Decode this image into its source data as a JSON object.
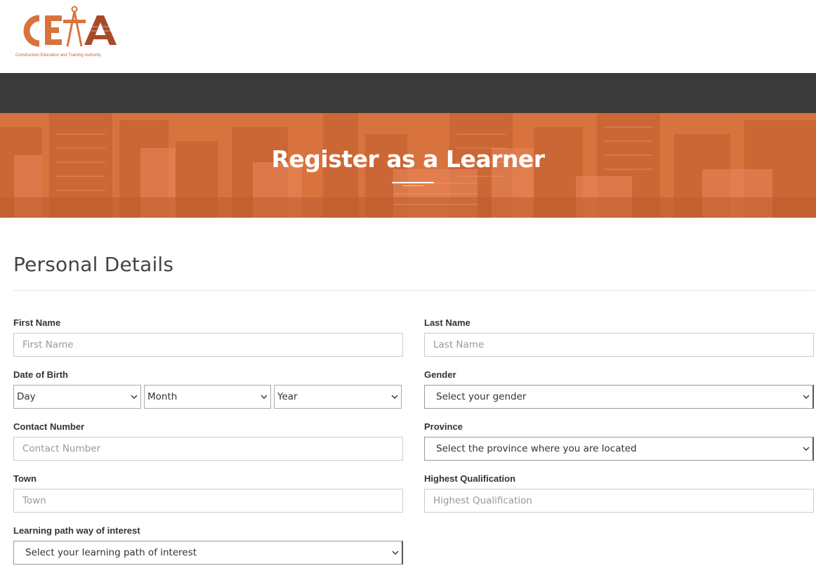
{
  "brand": {
    "logo_letters": "CETA",
    "tagline": "Construction Education and Training Authority",
    "color_accent": "#d9733e",
    "color_dark": "#3a3a3a"
  },
  "hero": {
    "title": "Register as a Learner"
  },
  "form": {
    "section_title": "Personal Details",
    "first_name": {
      "label": "First Name",
      "placeholder": "First Name"
    },
    "last_name": {
      "label": "Last Name",
      "placeholder": "Last Name"
    },
    "dob": {
      "label": "Date of Birth",
      "day": "Day",
      "month": "Month",
      "year": "Year"
    },
    "gender": {
      "label": "Gender",
      "value": "Select your gender"
    },
    "contact": {
      "label": "Contact Number",
      "placeholder": "Contact Number"
    },
    "province": {
      "label": "Province",
      "value": "Select the province where you are located"
    },
    "town": {
      "label": "Town",
      "placeholder": "Town"
    },
    "qualification": {
      "label": "Highest Qualification",
      "placeholder": "Highest Qualification"
    },
    "learning_path": {
      "label": "Learning path way of interest",
      "value": "Select your learning path of interest"
    }
  }
}
